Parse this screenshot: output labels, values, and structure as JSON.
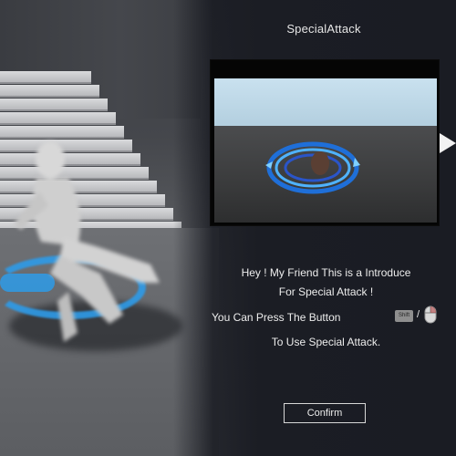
{
  "panel": {
    "title": "SpecialAttack",
    "message_line1": "Hey ! My Friend This is a Introduce",
    "message_line2": "For Special Attack !",
    "message_line3": "You Can Press The Button",
    "key_label": "Shift",
    "key_separator": "/",
    "message_line4": "To Use Special Attack.",
    "confirm_label": "Confirm",
    "input_icons": [
      "shift-key-icon",
      "mouse-icon"
    ],
    "nav_icon": "play-arrow-icon"
  },
  "colors": {
    "panel_bg": "#1b1d24",
    "text": "#ededed",
    "effect_blue": "#2e9be8",
    "sky": "#c9e1ef"
  }
}
